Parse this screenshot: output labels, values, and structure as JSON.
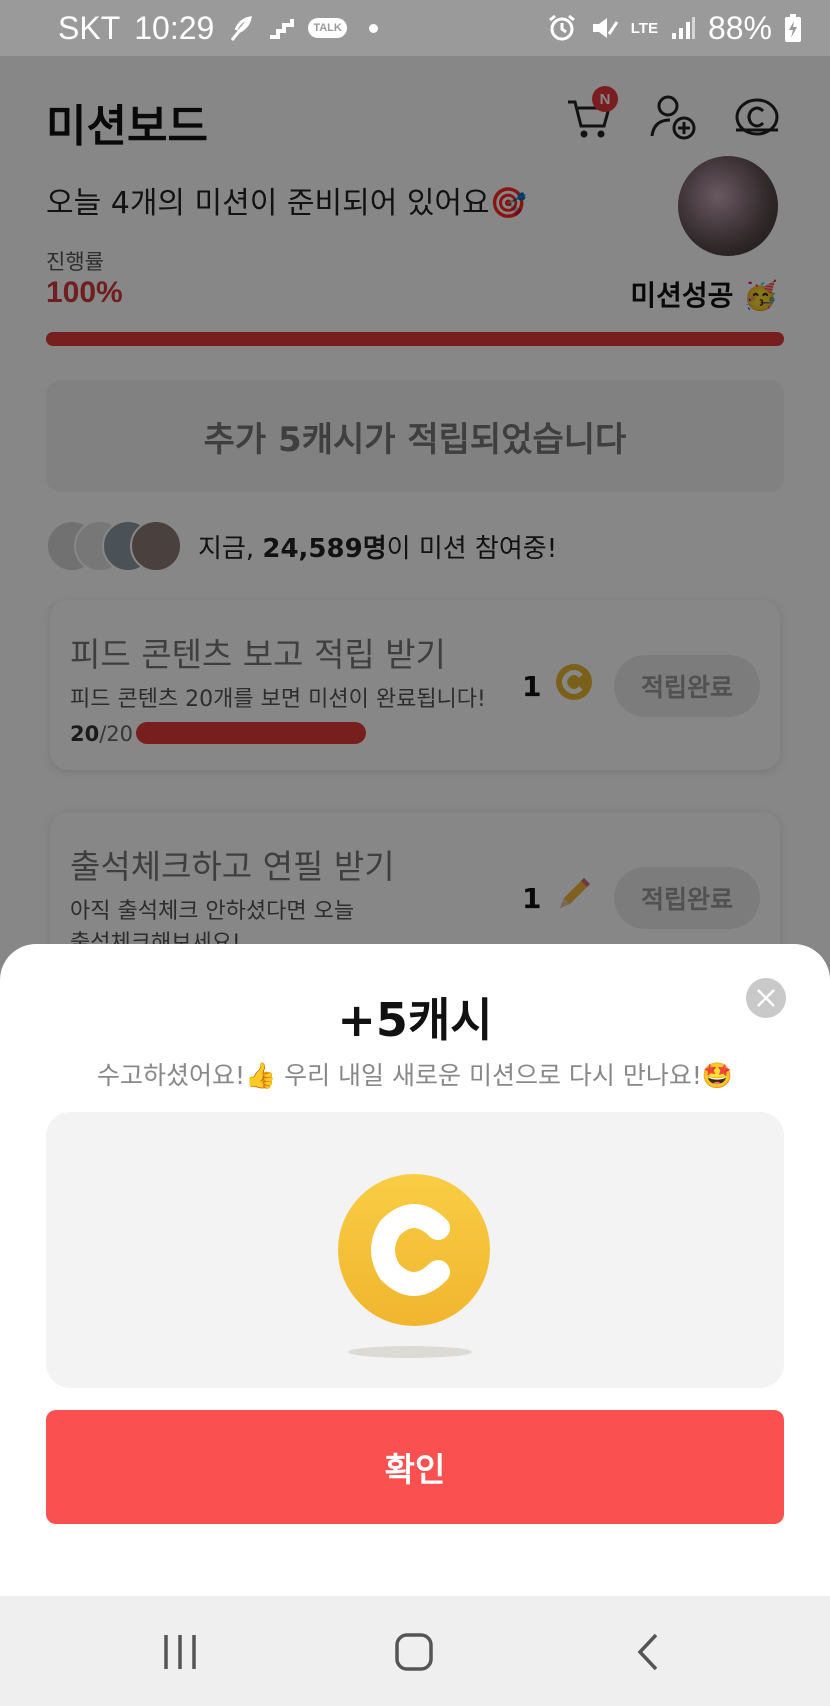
{
  "status_bar": {
    "carrier": "SKT",
    "time": "10:29",
    "talk_label": "TALK",
    "network": "LTE",
    "battery": "88%"
  },
  "header": {
    "title": "미션보드",
    "cart_badge": "N",
    "icons": [
      "cart-icon",
      "add-user-icon",
      "coin-outline-icon"
    ]
  },
  "board": {
    "prepared_text": "오늘 4개의 미션이 준비되어 있어요🎯",
    "progress_label": "진행률",
    "progress_percent": "100%",
    "progress_value": 1.0,
    "mission_success": "미션성공 🥳",
    "cash_banner": "추가 5캐시가 적립되었습니다",
    "participants_prefix": "지금, ",
    "participants_count": "24,589명",
    "participants_suffix": "이 미션 참여중!"
  },
  "missions": [
    {
      "title": "피드 콘텐츠 보고 적립 받기",
      "desc": "피드 콘텐츠 20개를 보면 미션이 완료됩니다!",
      "done": "20",
      "total": "/20",
      "reward": "1",
      "reward_icon": "coin-icon",
      "button": "적립완료"
    },
    {
      "title": "출석체크하고 연필 받기",
      "desc": "아직 출석체크 안하셨다면 오늘 출석체크해보세요!",
      "reward": "1",
      "reward_icon": "pencil-icon",
      "button": "적립완료"
    }
  ],
  "sheet": {
    "title": "+5캐시",
    "subtitle": "수고하셨어요!👍 우리 내일 새로운 미션으로 다시 만나요!🤩",
    "confirm_label": "확인"
  },
  "colors": {
    "accent_red": "#fa5050",
    "progress_red": "#e0393b",
    "coin_yellow": "#f5c23a"
  }
}
